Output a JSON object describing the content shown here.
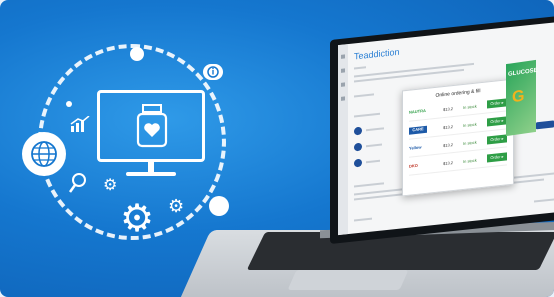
{
  "illustration": {
    "icons": [
      "monitor-icon",
      "medicine-jar-icon",
      "globe-icon",
      "chart-icon",
      "search-icon",
      "gear-icon",
      "info-icon"
    ]
  },
  "app": {
    "title": "Teaddiction"
  },
  "modal": {
    "title": "Online ordering & fill",
    "rows": [
      {
        "logo": "NAUTRA",
        "price": "$13.2",
        "stock": "In stock",
        "button": "Order ▸"
      },
      {
        "logo": "CARE",
        "price": "$13.2",
        "stock": "In stock",
        "button": "Order ▸"
      },
      {
        "logo": "Yellow",
        "price": "$13.2",
        "stock": "In stock",
        "button": "Order ▸"
      },
      {
        "logo": "DKO",
        "price": "$13.2",
        "stock": "In stock",
        "button": "Order ▸"
      }
    ]
  },
  "product": {
    "label": "GLUCOSE",
    "big_letter": "G"
  },
  "colors": {
    "background": "#1577cf",
    "accent_green": "#2e9e46",
    "accent_blue": "#1f4f9a",
    "product_yellow": "#f2b21c"
  }
}
